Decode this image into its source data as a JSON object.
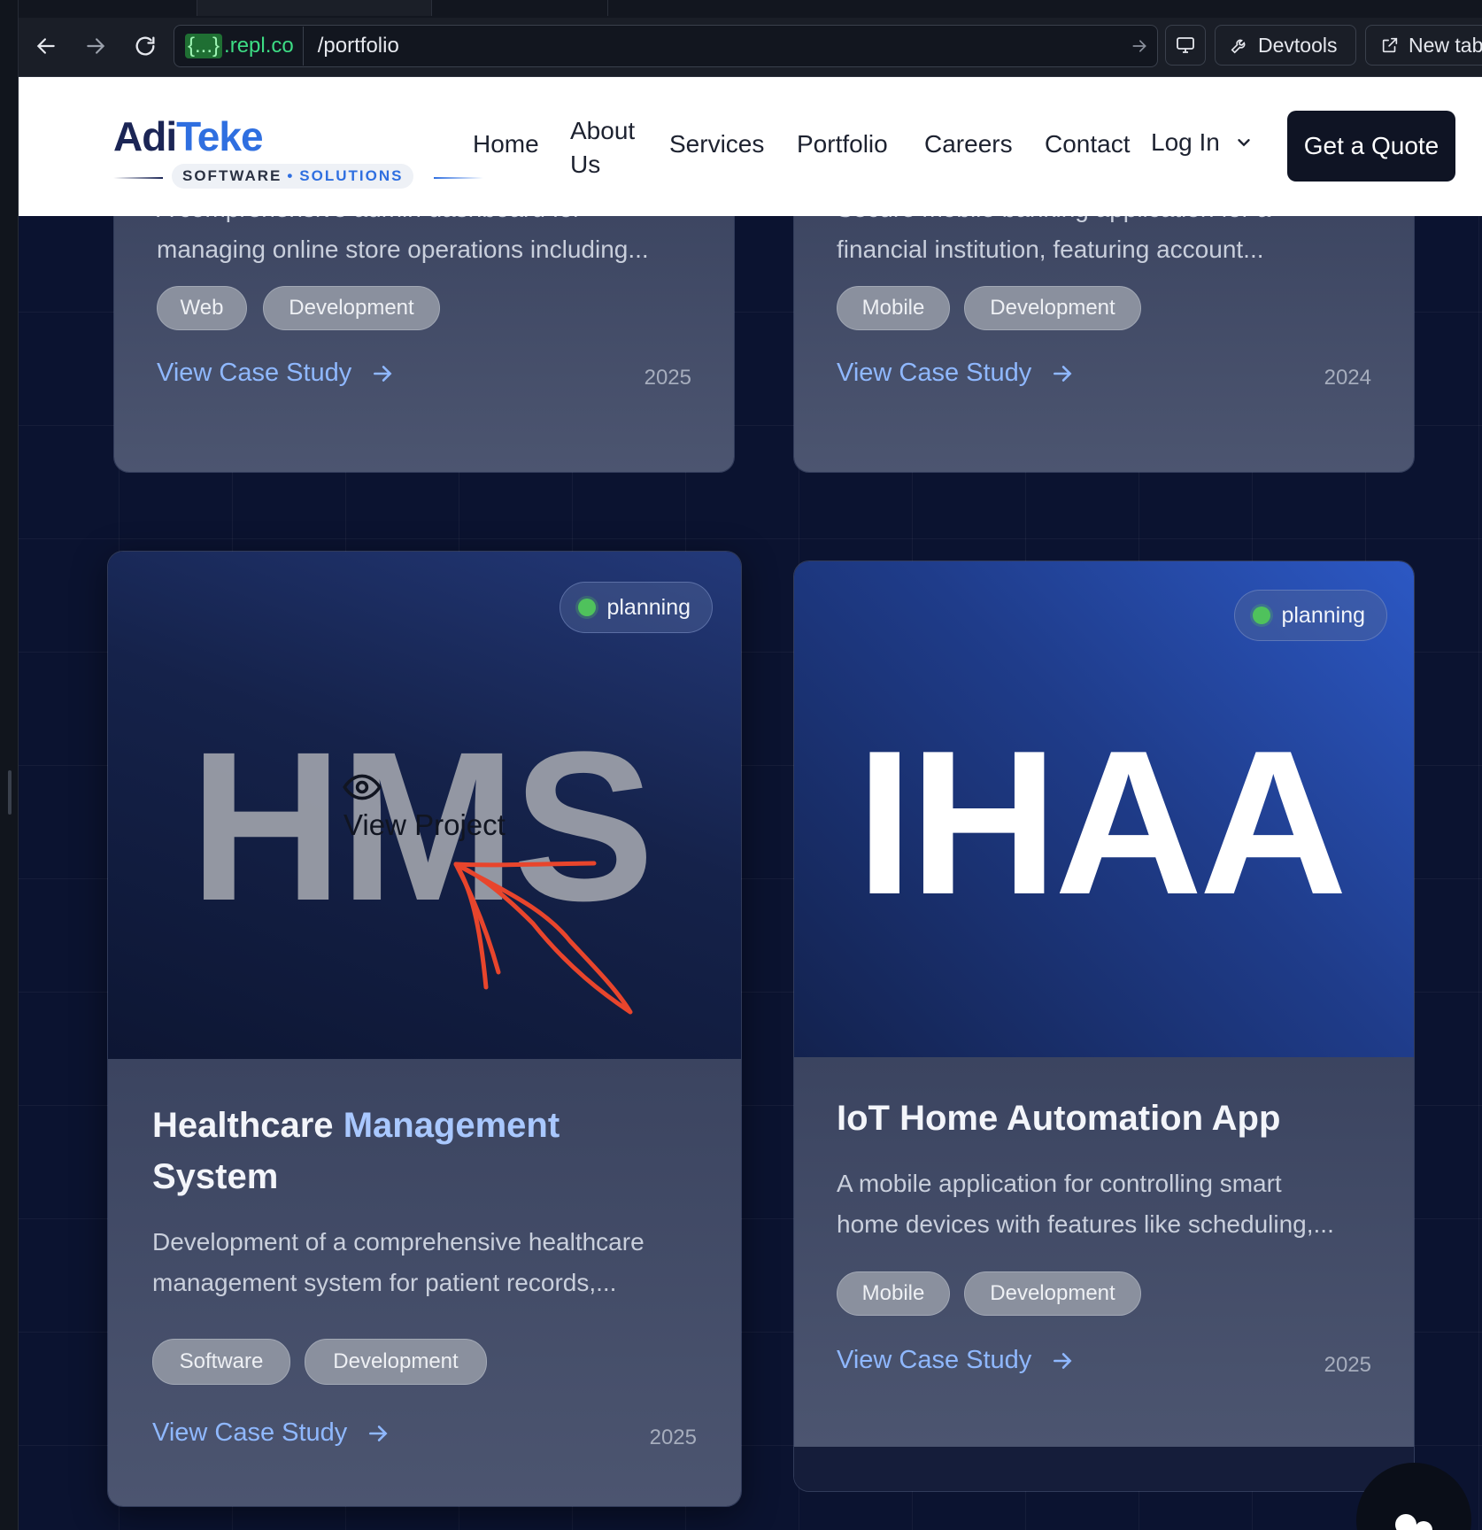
{
  "browser": {
    "url_host_brace": "{...}",
    "url_host": ".repl.co",
    "url_path": "/portfolio",
    "devtools_label": "Devtools",
    "newtab_label": "New tab"
  },
  "site": {
    "logo": {
      "part1": "Adi",
      "part2": "Teke",
      "sub1": "SOFTWARE",
      "dot": "•",
      "sub2": "SOLUTIONS"
    },
    "nav": {
      "home": "Home",
      "about_line1": "About",
      "about_line2": "Us",
      "services": "Services",
      "portfolio": "Portfolio",
      "careers": "Careers",
      "contact": "Contact",
      "login": "Log In",
      "quote": "Get a Quote"
    }
  },
  "projects": [
    {
      "desc_line1": "A comprehensive admin dashboard for",
      "desc_line2": "managing online store operations including...",
      "tags": [
        "Web",
        "Development"
      ],
      "link": "View Case Study",
      "year": "2025"
    },
    {
      "desc_line1": "Secure mobile banking application for a",
      "desc_line2": "financial institution, featuring account...",
      "tags": [
        "Mobile",
        "Development"
      ],
      "link": "View Case Study",
      "year": "2024"
    },
    {
      "status": "planning",
      "image_text": "HMS",
      "overlay_label": "View Project",
      "title_part1": "Healthcare",
      "title_part2": "Management",
      "title_part3": "System",
      "desc_line1": "Development of a comprehensive healthcare",
      "desc_line2": "management system for patient records,...",
      "tags": [
        "Software",
        "Development"
      ],
      "link": "View Case Study",
      "year": "2025"
    },
    {
      "status": "planning",
      "image_text": "IHAA",
      "title": "IoT Home Automation App",
      "desc_line1": "A mobile application for controlling smart",
      "desc_line2": "home devices with features like scheduling,...",
      "tags": [
        "Mobile",
        "Development"
      ],
      "link": "View Case Study",
      "year": "2025"
    }
  ],
  "colors": {
    "accent_link": "#8fb8ff",
    "status_dot": "#4fc25c",
    "annotation": "#e8452c",
    "page_bg": "#0b1330"
  }
}
